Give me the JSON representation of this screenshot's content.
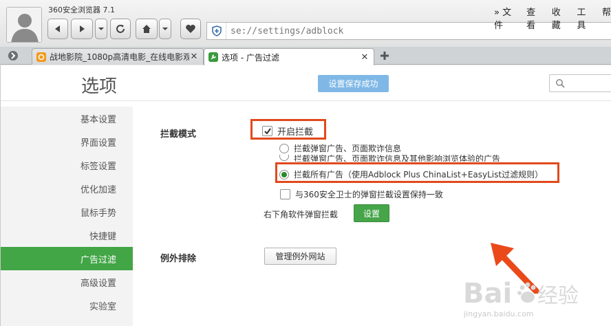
{
  "app": {
    "title": "360安全浏览器 7.1",
    "url": "se://settings/adblock",
    "menu": [
      "» 文件",
      "查看",
      "收藏",
      "工具",
      "帮"
    ]
  },
  "tabs": [
    {
      "label": "战地影院_1080p高清电影_在线电影观",
      "active": false
    },
    {
      "label": "选项 - 广告过滤",
      "active": true
    }
  ],
  "page": {
    "title": "选项",
    "save_status": "设置保存成功",
    "search_placeholder": ""
  },
  "sidebar": {
    "items": [
      {
        "label": "基本设置",
        "active": false
      },
      {
        "label": "界面设置",
        "active": false
      },
      {
        "label": "标签设置",
        "active": false
      },
      {
        "label": "优化加速",
        "active": false
      },
      {
        "label": "鼠标手势",
        "active": false
      },
      {
        "label": "快捷键",
        "active": false
      },
      {
        "label": "广告过滤",
        "active": true
      },
      {
        "label": "高级设置",
        "active": false
      },
      {
        "label": "实验室",
        "active": false
      }
    ]
  },
  "adblock": {
    "mode_label": "拦截模式",
    "enable_label": "开启拦截",
    "enable_checked": true,
    "radio_options": [
      {
        "label": "拦截弹窗广告、页面欺诈信息",
        "selected": false
      },
      {
        "label": "拦截弹窗广告、页面欺诈信息及其他影响浏览体验的广告",
        "selected": false
      },
      {
        "label": "拦截所有广告（使用Adblock Plus ChinaList+EasyList过滤规则）",
        "selected": true
      }
    ],
    "sync_label": "与360安全卫士的弹窗拦截设置保持一致",
    "sync_checked": false,
    "corner_popup_label": "右下角软件弹窗拦截",
    "corner_popup_button": "设置",
    "exception_label": "例外排除",
    "exception_button": "管理例外网站"
  },
  "colors": {
    "accent_green": "#42a546",
    "highlight_red": "#e2491b",
    "toast_blue": "#7fb8e6"
  },
  "watermark": {
    "brand": "Baidu经验",
    "url": "jingyan.baidu.com"
  }
}
